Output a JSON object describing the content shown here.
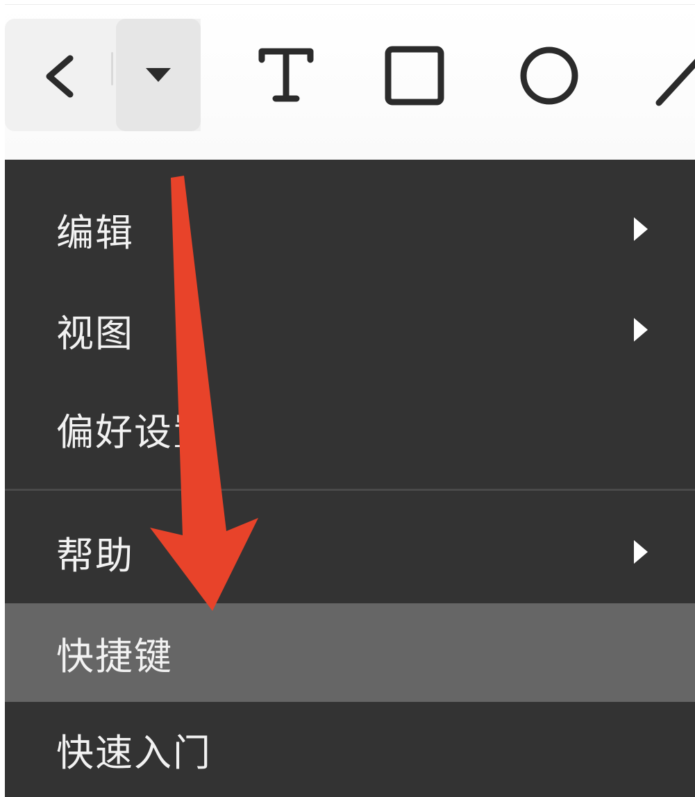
{
  "toolbar": {
    "tools": [
      {
        "name": "back",
        "icon": "chevron-left-icon"
      },
      {
        "name": "menu-toggle",
        "icon": "caret-down-icon"
      },
      {
        "name": "text",
        "icon": "text-tool-icon"
      },
      {
        "name": "rectangle",
        "icon": "rectangle-tool-icon"
      },
      {
        "name": "ellipse",
        "icon": "circle-tool-icon"
      },
      {
        "name": "line",
        "icon": "line-tool-icon"
      }
    ]
  },
  "menu": {
    "items": [
      {
        "label": "编辑",
        "has_submenu": true
      },
      {
        "label": "视图",
        "has_submenu": true
      },
      {
        "label": "偏好设置",
        "has_submenu": false
      },
      {
        "label": "帮助",
        "has_submenu": true
      },
      {
        "label": "快捷键",
        "has_submenu": false,
        "highlighted": true
      },
      {
        "label": "快速入门",
        "has_submenu": false
      }
    ]
  },
  "annotation": {
    "icon": "red-arrow-icon",
    "color": "#E8432A"
  },
  "colors": {
    "menu_bg": "#333333",
    "highlight_bg": "#666666",
    "menu_text": "#F2F2F2",
    "toolbar_bg": "#FFFFFF",
    "toolbar_group_bg": "#F1F1F1"
  }
}
